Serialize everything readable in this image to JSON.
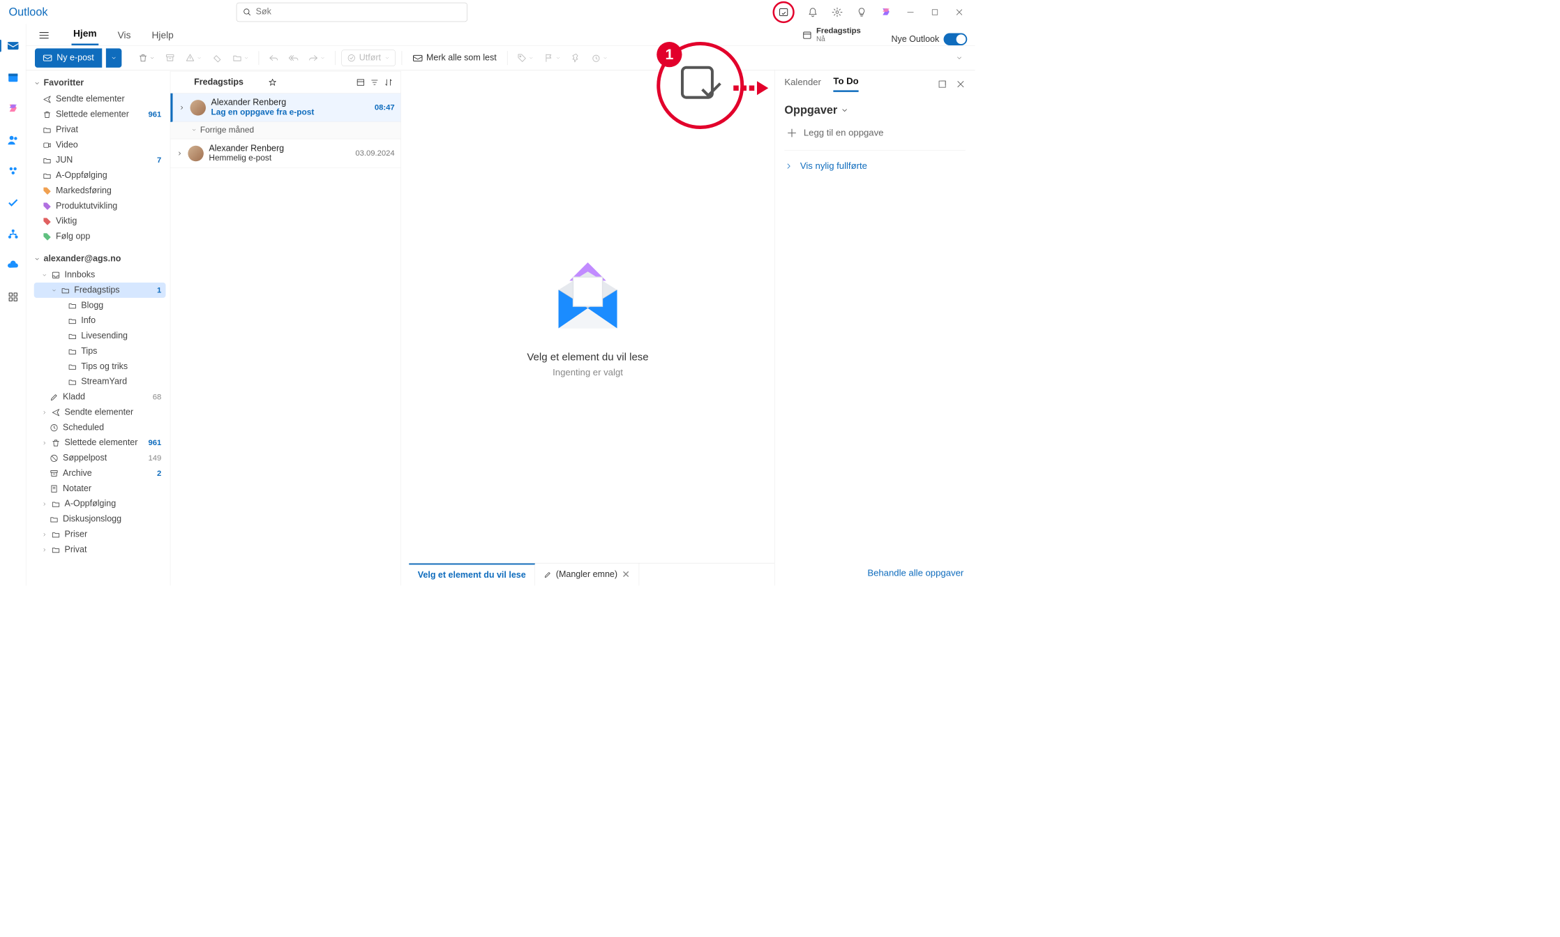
{
  "title": "Outlook",
  "search": {
    "placeholder": "Søk"
  },
  "tabs": {
    "hjem": "Hjem",
    "vis": "Vis",
    "hjelp": "Hjelp"
  },
  "tipCard": {
    "title": "Fredagstips",
    "sub": "Nå"
  },
  "toggle": {
    "label": "Nye Outlook"
  },
  "ribbon": {
    "newMail": "Ny e-post",
    "done": "Utført",
    "markRead": "Merk alle som lest"
  },
  "folders": {
    "favHeader": "Favoritter",
    "fav": [
      {
        "label": "Sendte elementer"
      },
      {
        "label": "Slettede elementer",
        "count": "961",
        "blue": true
      },
      {
        "label": "Privat"
      },
      {
        "label": "Video"
      },
      {
        "label": "JUN",
        "count": "7",
        "blue": true
      },
      {
        "label": "A-Oppfølging"
      },
      {
        "label": "Markedsføring"
      },
      {
        "label": "Produktutvikling"
      },
      {
        "label": "Viktig"
      },
      {
        "label": "Følg opp"
      }
    ],
    "account": "alexander@ags.no",
    "tree": [
      {
        "label": "Innboks",
        "indent": 1
      },
      {
        "label": "Fredagstips",
        "indent": 2,
        "count": "1",
        "blue": true,
        "sel": true
      },
      {
        "label": "Blogg",
        "indent": 3
      },
      {
        "label": "Info",
        "indent": 3
      },
      {
        "label": "Livesending",
        "indent": 3
      },
      {
        "label": "Tips",
        "indent": 3
      },
      {
        "label": "Tips og triks",
        "indent": 3
      },
      {
        "label": "StreamYard",
        "indent": 3
      },
      {
        "label": "Kladd",
        "indent": 1,
        "count": "68"
      },
      {
        "label": "Sendte elementer",
        "indent": 1
      },
      {
        "label": "Scheduled",
        "indent": 1
      },
      {
        "label": "Slettede elementer",
        "indent": 1,
        "count": "961",
        "blue": true
      },
      {
        "label": "Søppelpost",
        "indent": 1,
        "count": "149"
      },
      {
        "label": "Archive",
        "indent": 1,
        "count": "2",
        "blue": true
      },
      {
        "label": "Notater",
        "indent": 1
      },
      {
        "label": "A-Oppfølging",
        "indent": 1
      },
      {
        "label": "Diskusjonslogg",
        "indent": 1
      },
      {
        "label": "Priser",
        "indent": 1
      },
      {
        "label": "Privat",
        "indent": 1
      }
    ]
  },
  "list": {
    "header": "Fredagstips",
    "groups": [
      {
        "items": [
          {
            "sender": "Alexander Renberg",
            "subject": "Lag en oppgave fra e-post",
            "time": "08:47",
            "sel": true
          }
        ]
      },
      {
        "label": "Forrige måned",
        "items": [
          {
            "sender": "Alexander Renberg",
            "subject": "Hemmelig e-post",
            "time": "03.09.2024"
          }
        ]
      }
    ]
  },
  "reader": {
    "empty1": "Velg et element du vil lese",
    "empty2": "Ingenting er valgt",
    "tab1": "Velg et element du vil lese",
    "tab2": "(Mangler emne)"
  },
  "todo": {
    "tab1": "Kalender",
    "tab2": "To Do",
    "heading": "Oppgaver",
    "add": "Legg til en oppgave",
    "recent": "Vis nylig fullførte",
    "manage": "Behandle alle oppgaver"
  },
  "badge": "1"
}
